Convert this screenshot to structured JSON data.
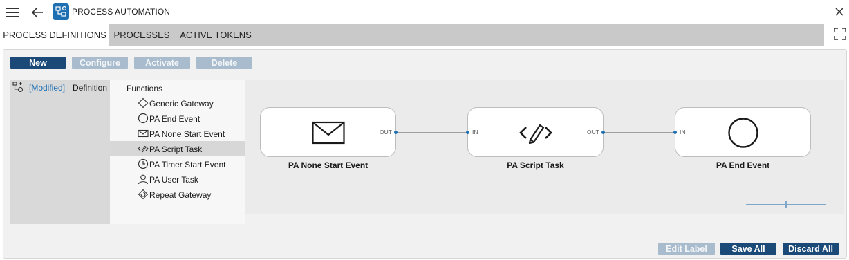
{
  "app": {
    "title": "PROCESS AUTOMATION",
    "icon": "process-automation-app-icon",
    "accent": "#1f6fb3"
  },
  "tabs": [
    {
      "label": "PROCESS DEFINITIONS",
      "active": true
    },
    {
      "label": "PROCESSES",
      "active": false
    },
    {
      "label": "ACTIVE TOKENS",
      "active": false
    }
  ],
  "toolbar": {
    "new": "New",
    "configure": "Configure",
    "activate": "Activate",
    "delete": "Delete"
  },
  "definitions": [
    {
      "status": "[Modified]",
      "name": "Definition",
      "icon": "process-definition-icon"
    }
  ],
  "palette": {
    "title": "Functions",
    "items": [
      {
        "label": "Generic Gateway",
        "icon": "diamond-icon"
      },
      {
        "label": "PA End Event",
        "icon": "circle-icon"
      },
      {
        "label": "PA None Start Event",
        "icon": "envelope-icon"
      },
      {
        "label": "PA Script Task",
        "icon": "script-icon",
        "selected": true
      },
      {
        "label": "PA Timer Start Event",
        "icon": "clock-icon"
      },
      {
        "label": "PA User Task",
        "icon": "user-icon"
      },
      {
        "label": "Repeat Gateway",
        "icon": "repeat-gateway-icon"
      }
    ]
  },
  "canvas": {
    "nodes": [
      {
        "label": "PA None Start Event",
        "icon": "envelope-icon",
        "in_port": "",
        "out_port": "OUT"
      },
      {
        "label": "PA Script Task",
        "icon": "script-icon",
        "in_port": "IN",
        "out_port": "OUT"
      },
      {
        "label": "PA End Event",
        "icon": "circle-icon",
        "in_port": "IN",
        "out_port": ""
      }
    ]
  },
  "footer": {
    "edit_label": "Edit Label",
    "save_all": "Save All",
    "discard_all": "Discard All"
  }
}
